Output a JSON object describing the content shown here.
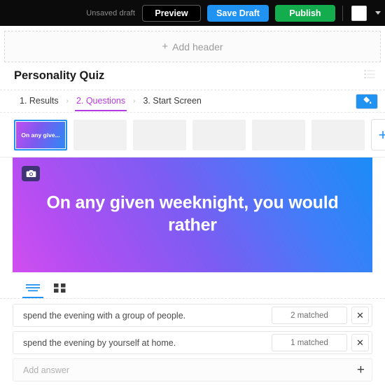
{
  "topbar": {
    "unsaved_label": "Unsaved draft",
    "preview_label": "Preview",
    "save_label": "Save Draft",
    "publish_label": "Publish"
  },
  "header_placeholder": {
    "plus": "+",
    "label": "Add header"
  },
  "page": {
    "title": "Personality Quiz"
  },
  "steps": {
    "separator": "›",
    "items": [
      {
        "label": "1. Results",
        "active": false
      },
      {
        "label": "2. Questions",
        "active": true
      },
      {
        "label": "3. Start Screen",
        "active": false
      }
    ]
  },
  "thumbnails": {
    "active_label": "On any give...",
    "empty_count": 5,
    "add_label": "+"
  },
  "slide": {
    "title": "On any given weeknight, you would rather",
    "gradient_from": "#d14ef0",
    "gradient_to": "#1b8cf6"
  },
  "view_toggle": {
    "list_label": "list-view",
    "grid_label": "grid-view"
  },
  "answers": {
    "rows": [
      {
        "text": "spend the evening with a group of people.",
        "matched": "2 matched",
        "remove": "✕"
      },
      {
        "text": "spend the evening by yourself at home.",
        "matched": "1 matched",
        "remove": "✕"
      }
    ],
    "add_placeholder": "Add answer",
    "add_plus": "+"
  },
  "colors": {
    "accent_blue": "#1f92f2",
    "accent_green": "#13ad4e",
    "accent_purple": "#b63ae0"
  }
}
